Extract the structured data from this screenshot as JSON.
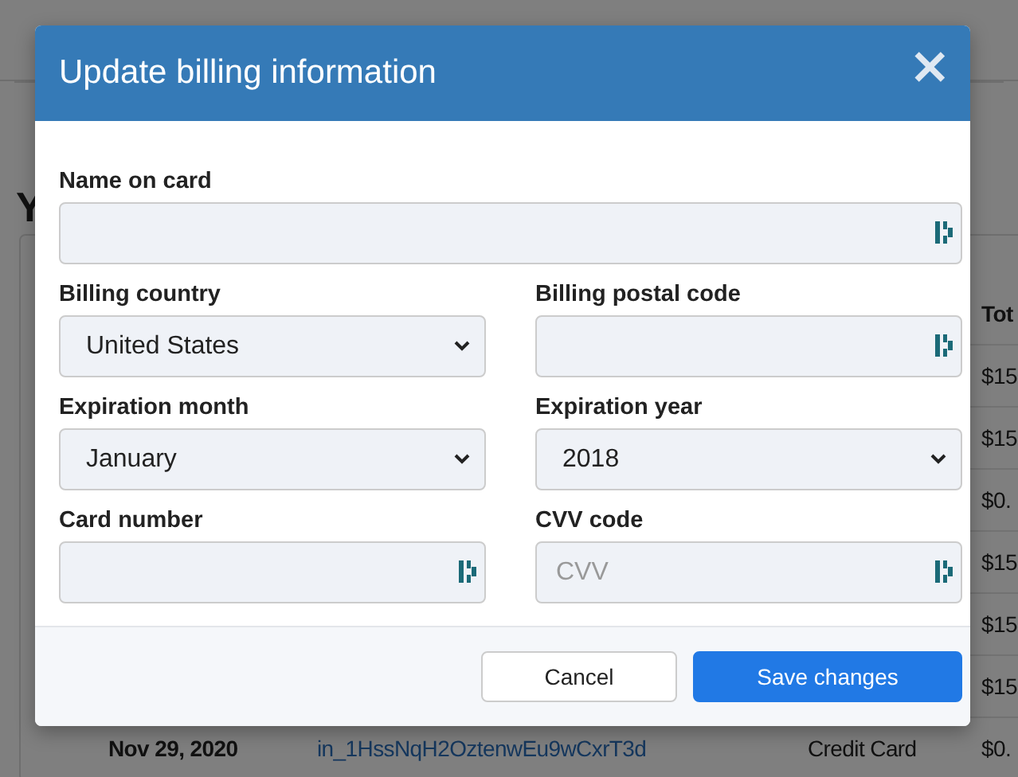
{
  "background_page": {
    "heading": "Y",
    "table": {
      "columns": [
        "Tot"
      ],
      "rows": [
        {
          "total": "$15"
        },
        {
          "total": "$15"
        },
        {
          "total": "$0."
        },
        {
          "total": "$15"
        },
        {
          "total": "$15"
        },
        {
          "total": "$15"
        },
        {
          "date": "Nov 29, 2020",
          "invoice": "in_1HssNqH2OztenwEu9wCxrT3d",
          "method": "Credit Card",
          "total": "$0."
        }
      ]
    }
  },
  "dialog": {
    "title": "Update billing information",
    "close": "×",
    "rows": [
      [
        {
          "label": "Name on card",
          "kind": "text"
        }
      ],
      [
        {
          "label": "Billing country",
          "kind": "select",
          "value": "United States"
        },
        {
          "label": "Billing postal code",
          "kind": "text"
        }
      ],
      [
        {
          "label": "Expiration month",
          "kind": "select",
          "value": "January"
        },
        {
          "label": "Expiration year",
          "kind": "select",
          "value": "2018"
        }
      ],
      [
        {
          "label": "Card number",
          "kind": "text"
        },
        {
          "label": "CVV code",
          "kind": "text",
          "placeholder": "CVV"
        }
      ]
    ],
    "buttons": [
      {
        "label": "Cancel",
        "kind": "secondary"
      },
      {
        "label": "Save changes",
        "kind": "primary"
      }
    ]
  }
}
